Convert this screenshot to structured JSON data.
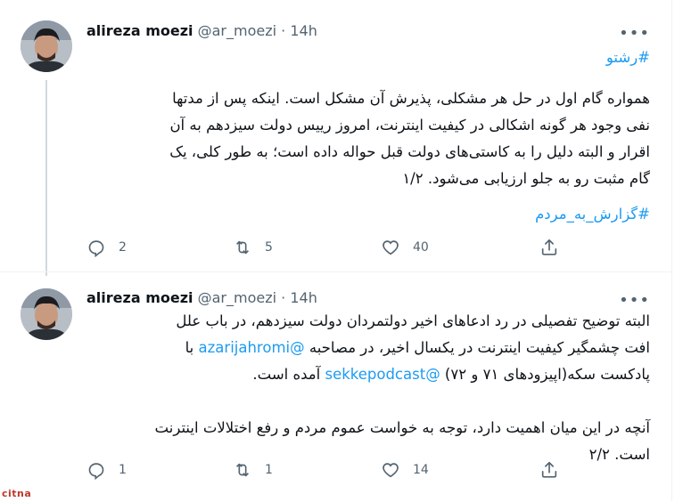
{
  "tweets": [
    {
      "author_name": "alireza moezi",
      "handle": "@ar_moezi",
      "separator": "·",
      "time": "14h",
      "hashtag_top": "#رشتو",
      "lines": [
        [
          {
            "text": "همواره گام اول در حل هر مشکلی، پذیرش آن مشکل است. اینکه پس از مدتها"
          }
        ],
        [
          {
            "text": "نفی وجود هر گونه اشکالی در کیفیت اینترنت، امروز رییس دولت سیزدهم به آن"
          }
        ],
        [
          {
            "text": "اقرار و البته دلیل را به کاستی‌های دولت قبل حواله داده است؛ به طور کلی، یک"
          }
        ],
        [
          {
            "text": "گام مثبت رو به جلو ارزیابی می‌شود. ۱/۲"
          }
        ]
      ],
      "hashtag_bottom": "#گزارش_به_مردم",
      "reply_count": "2",
      "retweet_count": "5",
      "like_count": "40"
    },
    {
      "author_name": "alireza moezi",
      "handle": "@ar_moezi",
      "separator": "·",
      "time": "14h",
      "lines": [
        [
          {
            "text": "البته توضیح تفصیلی در رد ادعاهای اخیر دولتمردان دولت سیزدهم، در باب علل"
          }
        ],
        [
          {
            "text": "افت چشمگیر کیفیت اینترنت در یکسال اخیر، در مصاحبه "
          },
          {
            "text": "@azarijahromi",
            "link": true
          },
          {
            "text": " با"
          }
        ],
        [
          {
            "text": "پادکست سکه(اپیزودهای ۷۱ و ۷۲) "
          },
          {
            "text": "@sekkepodcast",
            "link": true
          },
          {
            "text": " آمده است."
          }
        ],
        [
          {
            "text": ""
          }
        ],
        [
          {
            "text": "آنچه در این میان اهمیت دارد، توجه به خواست عموم مردم و رفع اختلالات اینترنت"
          }
        ],
        [
          {
            "text": "است. ۲/۲"
          }
        ]
      ],
      "reply_count": "1",
      "retweet_count": "1",
      "like_count": "14"
    }
  ],
  "watermark": "citna",
  "colors": {
    "link": "#1d9bf0",
    "muted": "#536471",
    "text": "#0f1419"
  },
  "icons": [
    "more-icon",
    "reply-icon",
    "retweet-icon",
    "like-icon",
    "share-icon"
  ]
}
